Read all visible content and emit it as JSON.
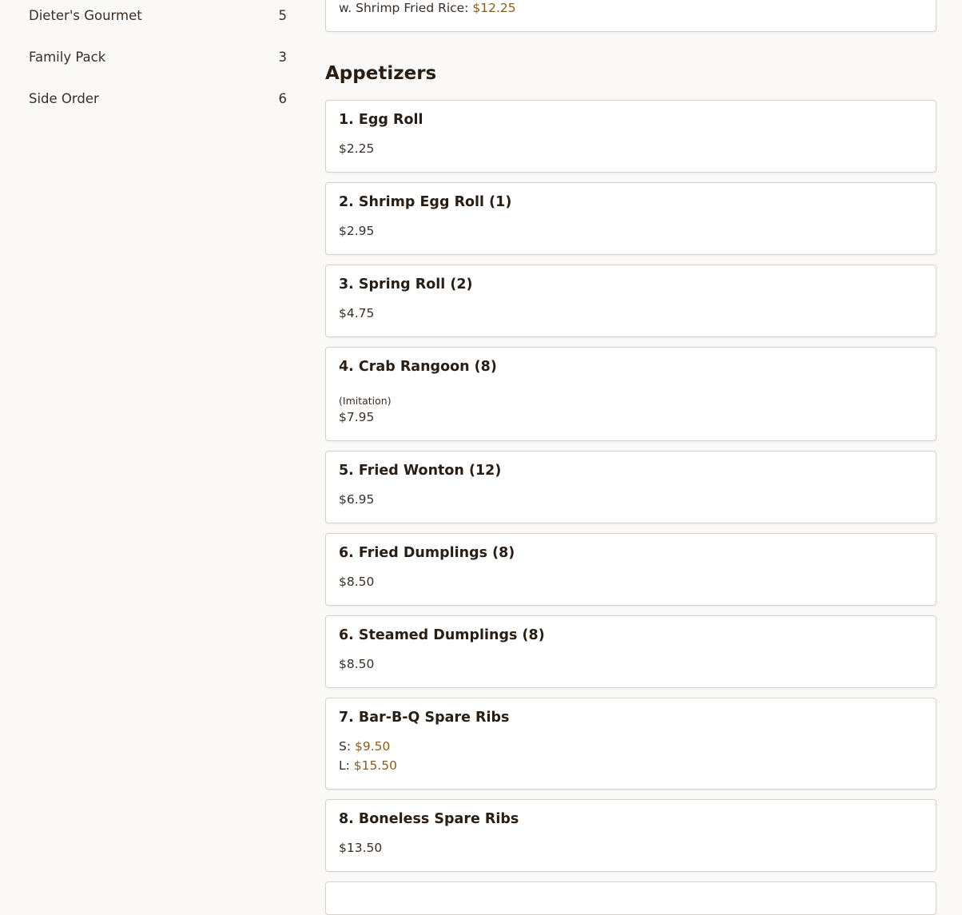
{
  "colors": {
    "background": "#faf9f7",
    "price": "#8a5c1c",
    "card_border": "#d7d2cc"
  },
  "sidebar": {
    "categories": [
      {
        "name": "Dieter's Gourmet",
        "count": "5"
      },
      {
        "name": "Family Pack",
        "count": "3"
      },
      {
        "name": "Side Order",
        "count": "6"
      }
    ]
  },
  "main": {
    "prev_card": {
      "label": "w. Shrimp Fried Rice:",
      "price": "$12.25"
    },
    "section_title": "Appetizers",
    "items": [
      {
        "name": "1. Egg Roll",
        "price": "$2.25"
      },
      {
        "name": "2. Shrimp Egg Roll (1)",
        "price": "$2.95"
      },
      {
        "name": "3. Spring Roll (2)",
        "price": "$4.75"
      },
      {
        "name": "4. Crab Rangoon (8)",
        "description": "(Imitation)",
        "price": "$7.95"
      },
      {
        "name": "5. Fried Wonton (12)",
        "price": "$6.95"
      },
      {
        "name": "6. Fried Dumplings (8)",
        "price": "$8.50"
      },
      {
        "name": "6. Steamed Dumplings (8)",
        "price": "$8.50"
      },
      {
        "name": "7. Bar-B-Q Spare Ribs",
        "price_small_label": "S:",
        "price_small": "$9.50",
        "price_large_label": "L:",
        "price_large": "$15.50"
      },
      {
        "name": "8. Boneless Spare Ribs",
        "price": "$13.50"
      }
    ]
  }
}
